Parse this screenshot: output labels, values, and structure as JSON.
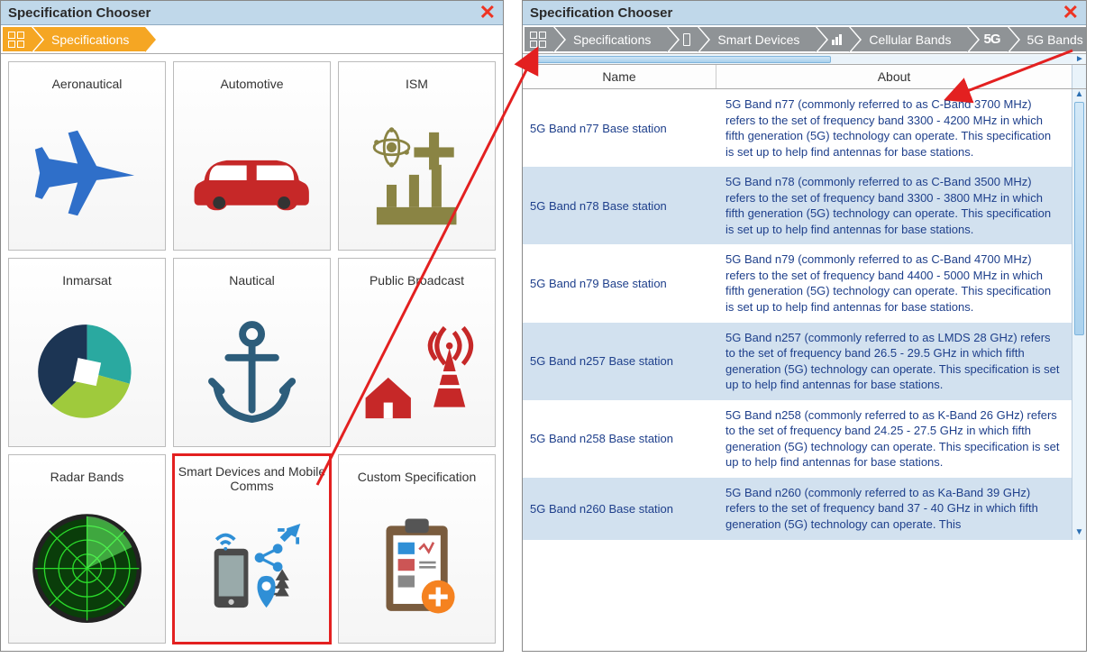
{
  "left": {
    "title": "Specification Chooser",
    "breadcrumb": {
      "label": "Specifications"
    },
    "tiles": [
      {
        "label": "Aeronautical"
      },
      {
        "label": "Automotive"
      },
      {
        "label": "ISM"
      },
      {
        "label": "Inmarsat"
      },
      {
        "label": "Nautical"
      },
      {
        "label": "Public Broadcast"
      },
      {
        "label": "Radar Bands"
      },
      {
        "label": "Smart Devices and Mobile Comms"
      },
      {
        "label": "Custom Specification"
      }
    ]
  },
  "right": {
    "title": "Specification Chooser",
    "breadcrumbs": [
      {
        "label": "Specifications"
      },
      {
        "label": "Smart Devices"
      },
      {
        "label": "Cellular Bands"
      },
      {
        "label": "5G Bands"
      }
    ],
    "columns": {
      "name": "Name",
      "about": "About"
    },
    "rows": [
      {
        "name": "5G Band n77 Base station",
        "about": "5G Band n77 (commonly referred to as C-Band 3700 MHz) refers to the set of frequency band 3300 - 4200 MHz in which fifth generation (5G) technology can operate. This specification is set up to help find antennas for base stations."
      },
      {
        "name": "5G Band n78 Base station",
        "about": "5G Band n78 (commonly referred to as C-Band 3500 MHz) refers to the set of frequency band 3300 - 3800 MHz in which fifth generation (5G) technology can operate. This specification is set up to help find antennas for base stations."
      },
      {
        "name": "5G Band n79 Base station",
        "about": "5G Band n79 (commonly referred to as C-Band 4700 MHz) refers to the set of frequency band 4400 - 5000 MHz in which fifth generation (5G) technology can operate. This specification is set up to help find antennas for base stations."
      },
      {
        "name": "5G Band n257 Base station",
        "about": "5G Band n257 (commonly referred to as LMDS 28 GHz) refers to the set of frequency band 26.5 - 29.5 GHz in which fifth generation (5G) technology can operate. This specification is set up to help find antennas for base stations."
      },
      {
        "name": "5G Band n258 Base station",
        "about": "5G Band n258  (commonly referred to as K-Band 26 GHz) refers to the set of frequency band 24.25 - 27.5 GHz in which fifth generation (5G) technology can operate. This specification is set up to help find antennas for base stations."
      },
      {
        "name": "5G Band n260 Base station",
        "about": "5G Band n260  (commonly referred to as Ka-Band 39 GHz) refers to the set of frequency band 37 - 40 GHz in which fifth generation (5G) technology can operate. This"
      }
    ]
  }
}
